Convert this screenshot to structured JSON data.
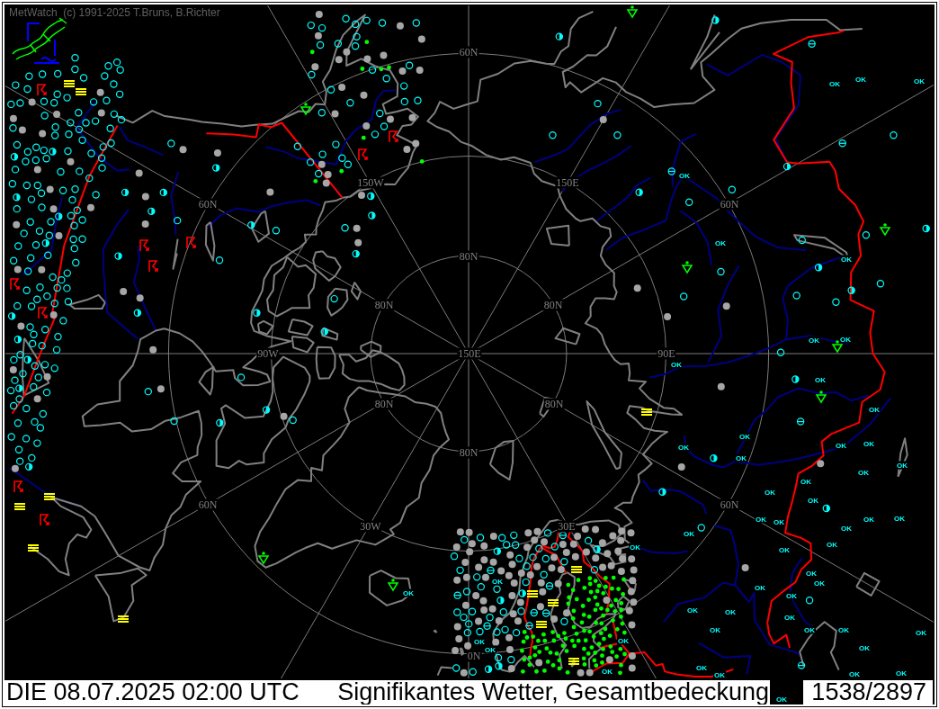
{
  "title": "MetWatch  (c) 1991-2025 T.Bruns, B.Richter",
  "map": {
    "grid_labels": [
      {
        "text": "60N"
      },
      {
        "text": "150W"
      },
      {
        "text": "150E"
      },
      {
        "text": "60N"
      },
      {
        "text": "60N"
      },
      {
        "text": "80N"
      },
      {
        "text": "80N"
      },
      {
        "text": "80N"
      },
      {
        "text": "90W"
      },
      {
        "text": "150E"
      },
      {
        "text": "90E"
      },
      {
        "text": "80N"
      },
      {
        "text": "80N"
      },
      {
        "text": "80N"
      },
      {
        "text": "60N"
      },
      {
        "text": "60N"
      },
      {
        "text": "30W"
      },
      {
        "text": "30E"
      },
      {
        "text": "0N"
      }
    ],
    "station_labels": [
      "OK",
      "OK",
      "OK",
      "OK",
      "OK",
      "OK",
      "OK",
      "OK",
      "OK",
      "OK",
      "OK",
      "OK",
      "OK",
      "OK",
      "OK",
      "OK",
      "OK",
      "OK",
      "OK",
      "OK",
      "OK",
      "OK",
      "OK",
      "OK",
      "OK",
      "OK",
      "OK",
      "OK",
      "OK",
      "OK",
      "OK",
      "OK",
      "OK",
      "OK",
      "OK",
      "OK",
      "OK",
      "OK",
      "OK",
      "OK",
      "OK",
      "OK",
      "OK",
      "OK",
      "OK",
      "OK",
      "OK",
      "OK",
      "OK",
      "OK",
      "OK",
      "OK",
      "OK"
    ]
  },
  "status_bar": {
    "date_time": "DIE 08.07.2025 02:00 UTC",
    "product": "Signifikantes Wetter, Gesamtbedeckung",
    "frame_counter": "1538/2897"
  }
}
